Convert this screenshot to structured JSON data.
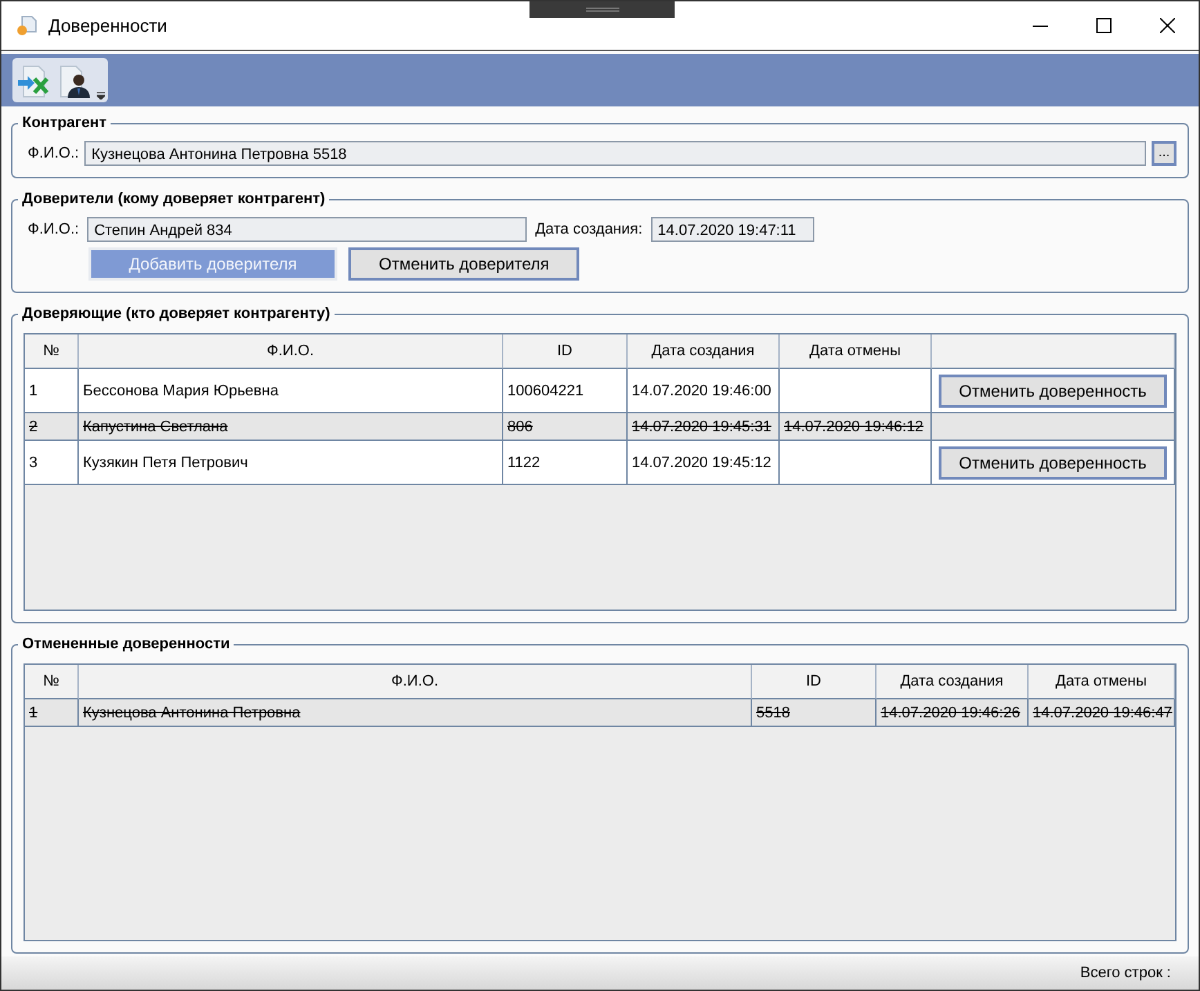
{
  "window": {
    "title": "Доверенности"
  },
  "counterparty": {
    "legend": "Контрагент",
    "fio_label": "Ф.И.О.:",
    "fio_value": "Кузнецова Антонина Петровна 5518",
    "browse_button": "..."
  },
  "principals": {
    "legend": "Доверители (кому доверяет контрагент)",
    "fio_label": "Ф.И.О.:",
    "fio_value": "Степин Андрей 834",
    "date_label": "Дата создания:",
    "date_value": "14.07.2020 19:47:11",
    "buttons": [
      {
        "label": "Добавить доверителя",
        "disabled": true
      },
      {
        "label": "Отменить доверителя",
        "disabled": false
      }
    ]
  },
  "trusting": {
    "legend": "Доверяющие (кто доверяет контрагенту)",
    "columns": [
      "№",
      "Ф.И.О.",
      "ID",
      "Дата создания",
      "Дата отмены"
    ],
    "rows": [
      {
        "no": "1",
        "fio": "Бессонова Мария Юрьевна",
        "id": "100604221",
        "created": "14.07.2020 19:46:00",
        "action": "Отменить доверенность",
        "revoked": false
      },
      {
        "no": "2",
        "fio": "Капустина Светлана",
        "id": "806",
        "created": "14.07.2020 19:45:31",
        "cancelled": "14.07.2020 19:46:12",
        "revoked": true
      },
      {
        "no": "3",
        "fio": "Кузякин Петя Петрович",
        "id": "1122",
        "created": "14.07.2020 19:45:12",
        "action": "Отменить доверенность",
        "revoked": false
      }
    ]
  },
  "cancelled": {
    "legend": "Отмененные доверенности",
    "columns": [
      "№",
      "Ф.И.О.",
      "ID",
      "Дата создания",
      "Дата отмены"
    ],
    "rows": [
      {
        "no": "1",
        "fio": "Кузнецова Антонина Петровна",
        "id": "5518",
        "created": "14.07.2020 19:46:26",
        "cancelled": "14.07.2020 19:46:47",
        "revoked": true
      }
    ]
  },
  "status_bar": {
    "total_label": "Всего строк :"
  }
}
